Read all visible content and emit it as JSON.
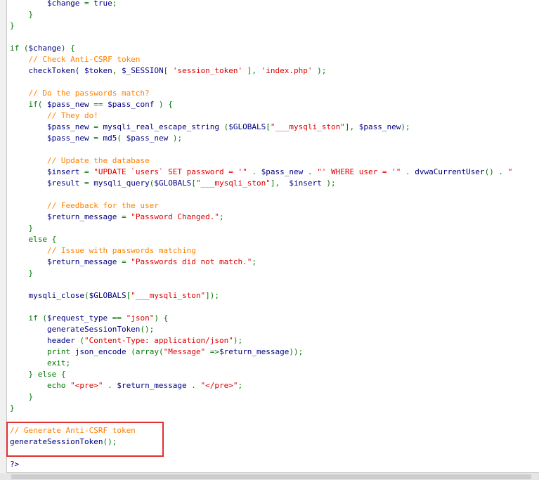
{
  "lines": [
    {
      "parts": [
        [
          "        ",
          "v"
        ],
        [
          "$change",
          "v"
        ],
        [
          " = ",
          "g"
        ],
        [
          "true",
          "v"
        ],
        [
          ";",
          "g"
        ]
      ]
    },
    {
      "parts": [
        [
          "    }",
          "g"
        ]
      ]
    },
    {
      "parts": [
        [
          "}",
          "g"
        ]
      ]
    },
    {
      "parts": [
        [
          "",
          ""
        ]
      ]
    },
    {
      "parts": [
        [
          "if (",
          "g"
        ],
        [
          "$change",
          "v"
        ],
        [
          ") {",
          "g"
        ]
      ]
    },
    {
      "parts": [
        [
          "    // Check Anti-CSRF token",
          "c"
        ]
      ]
    },
    {
      "parts": [
        [
          "    checkToken( ",
          "v"
        ],
        [
          "$token",
          "v"
        ],
        [
          ", ",
          "g"
        ],
        [
          "$_SESSION",
          "v"
        ],
        [
          "[ ",
          "g"
        ],
        [
          "'session_token'",
          "s"
        ],
        [
          " ], ",
          "g"
        ],
        [
          "'index.php'",
          "s"
        ],
        [
          " );",
          "g"
        ]
      ]
    },
    {
      "parts": [
        [
          "",
          ""
        ]
      ]
    },
    {
      "parts": [
        [
          "    // Do the passwords match?",
          "c"
        ]
      ]
    },
    {
      "parts": [
        [
          "    if( ",
          "g"
        ],
        [
          "$pass_new",
          "v"
        ],
        [
          " == ",
          "g"
        ],
        [
          "$pass_conf",
          "v"
        ],
        [
          " ) {",
          "g"
        ]
      ]
    },
    {
      "parts": [
        [
          "        // They do!",
          "c"
        ]
      ]
    },
    {
      "parts": [
        [
          "        ",
          "v"
        ],
        [
          "$pass_new",
          "v"
        ],
        [
          " = ",
          "g"
        ],
        [
          "mysqli_real_escape_string",
          "v"
        ],
        [
          " (",
          "g"
        ],
        [
          "$GLOBALS",
          "v"
        ],
        [
          "[",
          "g"
        ],
        [
          "\"___mysqli_ston\"",
          "s"
        ],
        [
          "], ",
          "g"
        ],
        [
          "$pass_new",
          "v"
        ],
        [
          ");",
          "g"
        ]
      ]
    },
    {
      "parts": [
        [
          "        ",
          "v"
        ],
        [
          "$pass_new",
          "v"
        ],
        [
          " = ",
          "g"
        ],
        [
          "md5",
          "v"
        ],
        [
          "( ",
          "g"
        ],
        [
          "$pass_new",
          "v"
        ],
        [
          " );",
          "g"
        ]
      ]
    },
    {
      "parts": [
        [
          "",
          ""
        ]
      ]
    },
    {
      "parts": [
        [
          "        // Update the database",
          "c"
        ]
      ]
    },
    {
      "parts": [
        [
          "        ",
          "v"
        ],
        [
          "$insert",
          "v"
        ],
        [
          " = ",
          "g"
        ],
        [
          "\"UPDATE `users` SET password = '\"",
          "s"
        ],
        [
          " . ",
          "g"
        ],
        [
          "$pass_new",
          "v"
        ],
        [
          " . ",
          "g"
        ],
        [
          "\"' WHERE user = '\"",
          "s"
        ],
        [
          " . ",
          "g"
        ],
        [
          "dvwaCurrentUser",
          "v"
        ],
        [
          "() . ",
          "g"
        ],
        [
          "\"",
          "s"
        ]
      ]
    },
    {
      "parts": [
        [
          "        ",
          "v"
        ],
        [
          "$result",
          "v"
        ],
        [
          " = ",
          "g"
        ],
        [
          "mysqli_query",
          "v"
        ],
        [
          "(",
          "g"
        ],
        [
          "$GLOBALS",
          "v"
        ],
        [
          "[",
          "g"
        ],
        [
          "\"___mysqli_ston\"",
          "s"
        ],
        [
          "],  ",
          "g"
        ],
        [
          "$insert",
          "v"
        ],
        [
          " );",
          "g"
        ]
      ]
    },
    {
      "parts": [
        [
          "",
          ""
        ]
      ]
    },
    {
      "parts": [
        [
          "        // Feedback for the user",
          "c"
        ]
      ]
    },
    {
      "parts": [
        [
          "        ",
          "v"
        ],
        [
          "$return_message",
          "v"
        ],
        [
          " = ",
          "g"
        ],
        [
          "\"Password Changed.\"",
          "s"
        ],
        [
          ";",
          "g"
        ]
      ]
    },
    {
      "parts": [
        [
          "    }",
          "g"
        ]
      ]
    },
    {
      "parts": [
        [
          "    else {",
          "g"
        ]
      ]
    },
    {
      "parts": [
        [
          "        // Issue with passwords matching",
          "c"
        ]
      ]
    },
    {
      "parts": [
        [
          "        ",
          "v"
        ],
        [
          "$return_message",
          "v"
        ],
        [
          " = ",
          "g"
        ],
        [
          "\"Passwords did not match.\"",
          "s"
        ],
        [
          ";",
          "g"
        ]
      ]
    },
    {
      "parts": [
        [
          "    }",
          "g"
        ]
      ]
    },
    {
      "parts": [
        [
          "",
          ""
        ]
      ]
    },
    {
      "parts": [
        [
          "    mysqli_close",
          "v"
        ],
        [
          "(",
          "g"
        ],
        [
          "$GLOBALS",
          "v"
        ],
        [
          "[",
          "g"
        ],
        [
          "\"___mysqli_ston\"",
          "s"
        ],
        [
          "]);",
          "g"
        ]
      ]
    },
    {
      "parts": [
        [
          "",
          ""
        ]
      ]
    },
    {
      "parts": [
        [
          "    if (",
          "g"
        ],
        [
          "$request_type",
          "v"
        ],
        [
          " == ",
          "g"
        ],
        [
          "\"json\"",
          "s"
        ],
        [
          ") {",
          "g"
        ]
      ]
    },
    {
      "parts": [
        [
          "        generateSessionToken",
          "v"
        ],
        [
          "();",
          "g"
        ]
      ]
    },
    {
      "parts": [
        [
          "        header ",
          "v"
        ],
        [
          "(",
          "g"
        ],
        [
          "\"Content-Type: application/json\"",
          "s"
        ],
        [
          ");",
          "g"
        ]
      ]
    },
    {
      "parts": [
        [
          "        print ",
          "g"
        ],
        [
          "json_encode ",
          "v"
        ],
        [
          "(",
          "g"
        ],
        [
          "array",
          "g"
        ],
        [
          "(",
          "g"
        ],
        [
          "\"Message\"",
          "s"
        ],
        [
          " =>",
          "g"
        ],
        [
          "$return_message",
          "v"
        ],
        [
          "));",
          "g"
        ]
      ]
    },
    {
      "parts": [
        [
          "        exit;",
          "g"
        ]
      ]
    },
    {
      "parts": [
        [
          "    } else {",
          "g"
        ]
      ]
    },
    {
      "parts": [
        [
          "        echo ",
          "g"
        ],
        [
          "\"<pre>\"",
          "s"
        ],
        [
          " . ",
          "g"
        ],
        [
          "$return_message",
          "v"
        ],
        [
          " . ",
          "g"
        ],
        [
          "\"</pre>\"",
          "s"
        ],
        [
          ";",
          "g"
        ]
      ]
    },
    {
      "parts": [
        [
          "    }",
          "g"
        ]
      ]
    },
    {
      "parts": [
        [
          "}",
          "g"
        ]
      ]
    },
    {
      "parts": [
        [
          "",
          ""
        ]
      ]
    },
    {
      "parts": [
        [
          "// Generate Anti-CSRF token",
          "c"
        ]
      ]
    },
    {
      "parts": [
        [
          "generateSessionToken",
          "v"
        ],
        [
          "();",
          "g"
        ]
      ]
    },
    {
      "parts": [
        [
          "",
          ""
        ]
      ]
    },
    {
      "parts": [
        [
          "?>",
          "v"
        ]
      ]
    }
  ],
  "highlight_label": "highlighted-region"
}
